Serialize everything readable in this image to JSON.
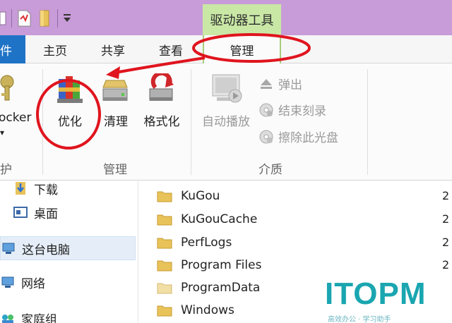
{
  "title_bar": {
    "context_tab_label": "驱动器工具",
    "qa_icons": [
      "check-icon",
      "document-icon",
      "folder-icon",
      "dropdown-icon"
    ]
  },
  "tabs": [
    {
      "id": "file",
      "label": "件"
    },
    {
      "id": "home",
      "label": "主页"
    },
    {
      "id": "share",
      "label": "共享"
    },
    {
      "id": "view",
      "label": "查看"
    },
    {
      "id": "manage",
      "label": "管理"
    }
  ],
  "ribbon": {
    "left_group": {
      "label": "护",
      "button_label": "ocker",
      "arrow": "▾"
    },
    "manage_group": {
      "label": "管理",
      "buttons": [
        {
          "label": "优化",
          "icon": "optimize-icon"
        },
        {
          "label": "清理",
          "icon": "cleanup-icon"
        },
        {
          "label": "格式化",
          "icon": "format-icon"
        }
      ]
    },
    "media_group": {
      "label": "介质",
      "autoplay": "自动播放",
      "eject": "弹出",
      "finish_burning": "结束刻录",
      "erase_disc": "擦除此光盘"
    }
  },
  "nav_pane": {
    "items": [
      {
        "label": "下载",
        "icon": "download-icon"
      },
      {
        "label": "桌面",
        "icon": "desktop-icon"
      },
      {
        "label": "这台电脑",
        "icon": "computer-icon"
      },
      {
        "label": "网络",
        "icon": "network-icon"
      },
      {
        "label": "家庭组",
        "icon": "homegroup-icon"
      }
    ]
  },
  "files": [
    {
      "name": "KuGou",
      "date": "2"
    },
    {
      "name": "KuGouCache",
      "date": "2"
    },
    {
      "name": "PerfLogs",
      "date": "2"
    },
    {
      "name": "Program Files",
      "date": "2"
    },
    {
      "name": "ProgramData",
      "date": "2"
    },
    {
      "name": "Windows",
      "date": "2"
    }
  ],
  "watermark": {
    "text": "ITOPM",
    "subtext": "高效办公 · 学习助手"
  },
  "colors": {
    "title_bar": "#c89cd8",
    "context_tab": "#c9e8a6",
    "file_tab": "#1f73c6",
    "annotation": "#e0141e",
    "folder": "#e8c35a",
    "watermark": "#1aa6b0"
  }
}
